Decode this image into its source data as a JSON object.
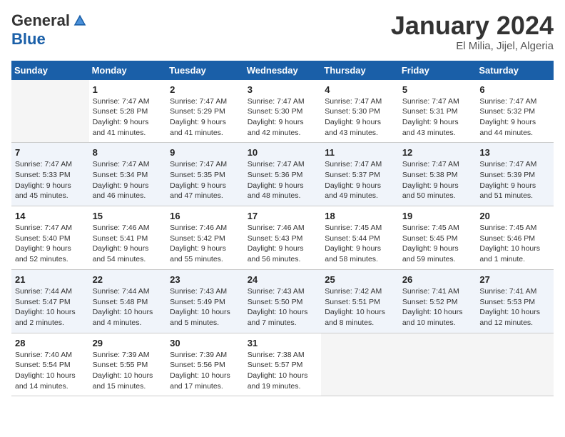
{
  "header": {
    "logo_general": "General",
    "logo_blue": "Blue",
    "month_title": "January 2024",
    "location": "El Milia, Jijel, Algeria"
  },
  "columns": [
    "Sunday",
    "Monday",
    "Tuesday",
    "Wednesday",
    "Thursday",
    "Friday",
    "Saturday"
  ],
  "weeks": [
    [
      {
        "day": "",
        "info": ""
      },
      {
        "day": "1",
        "info": "Sunrise: 7:47 AM\nSunset: 5:28 PM\nDaylight: 9 hours\nand 41 minutes."
      },
      {
        "day": "2",
        "info": "Sunrise: 7:47 AM\nSunset: 5:29 PM\nDaylight: 9 hours\nand 41 minutes."
      },
      {
        "day": "3",
        "info": "Sunrise: 7:47 AM\nSunset: 5:30 PM\nDaylight: 9 hours\nand 42 minutes."
      },
      {
        "day": "4",
        "info": "Sunrise: 7:47 AM\nSunset: 5:30 PM\nDaylight: 9 hours\nand 43 minutes."
      },
      {
        "day": "5",
        "info": "Sunrise: 7:47 AM\nSunset: 5:31 PM\nDaylight: 9 hours\nand 43 minutes."
      },
      {
        "day": "6",
        "info": "Sunrise: 7:47 AM\nSunset: 5:32 PM\nDaylight: 9 hours\nand 44 minutes."
      }
    ],
    [
      {
        "day": "7",
        "info": "Sunrise: 7:47 AM\nSunset: 5:33 PM\nDaylight: 9 hours\nand 45 minutes."
      },
      {
        "day": "8",
        "info": "Sunrise: 7:47 AM\nSunset: 5:34 PM\nDaylight: 9 hours\nand 46 minutes."
      },
      {
        "day": "9",
        "info": "Sunrise: 7:47 AM\nSunset: 5:35 PM\nDaylight: 9 hours\nand 47 minutes."
      },
      {
        "day": "10",
        "info": "Sunrise: 7:47 AM\nSunset: 5:36 PM\nDaylight: 9 hours\nand 48 minutes."
      },
      {
        "day": "11",
        "info": "Sunrise: 7:47 AM\nSunset: 5:37 PM\nDaylight: 9 hours\nand 49 minutes."
      },
      {
        "day": "12",
        "info": "Sunrise: 7:47 AM\nSunset: 5:38 PM\nDaylight: 9 hours\nand 50 minutes."
      },
      {
        "day": "13",
        "info": "Sunrise: 7:47 AM\nSunset: 5:39 PM\nDaylight: 9 hours\nand 51 minutes."
      }
    ],
    [
      {
        "day": "14",
        "info": "Sunrise: 7:47 AM\nSunset: 5:40 PM\nDaylight: 9 hours\nand 52 minutes."
      },
      {
        "day": "15",
        "info": "Sunrise: 7:46 AM\nSunset: 5:41 PM\nDaylight: 9 hours\nand 54 minutes."
      },
      {
        "day": "16",
        "info": "Sunrise: 7:46 AM\nSunset: 5:42 PM\nDaylight: 9 hours\nand 55 minutes."
      },
      {
        "day": "17",
        "info": "Sunrise: 7:46 AM\nSunset: 5:43 PM\nDaylight: 9 hours\nand 56 minutes."
      },
      {
        "day": "18",
        "info": "Sunrise: 7:45 AM\nSunset: 5:44 PM\nDaylight: 9 hours\nand 58 minutes."
      },
      {
        "day": "19",
        "info": "Sunrise: 7:45 AM\nSunset: 5:45 PM\nDaylight: 9 hours\nand 59 minutes."
      },
      {
        "day": "20",
        "info": "Sunrise: 7:45 AM\nSunset: 5:46 PM\nDaylight: 10 hours\nand 1 minute."
      }
    ],
    [
      {
        "day": "21",
        "info": "Sunrise: 7:44 AM\nSunset: 5:47 PM\nDaylight: 10 hours\nand 2 minutes."
      },
      {
        "day": "22",
        "info": "Sunrise: 7:44 AM\nSunset: 5:48 PM\nDaylight: 10 hours\nand 4 minutes."
      },
      {
        "day": "23",
        "info": "Sunrise: 7:43 AM\nSunset: 5:49 PM\nDaylight: 10 hours\nand 5 minutes."
      },
      {
        "day": "24",
        "info": "Sunrise: 7:43 AM\nSunset: 5:50 PM\nDaylight: 10 hours\nand 7 minutes."
      },
      {
        "day": "25",
        "info": "Sunrise: 7:42 AM\nSunset: 5:51 PM\nDaylight: 10 hours\nand 8 minutes."
      },
      {
        "day": "26",
        "info": "Sunrise: 7:41 AM\nSunset: 5:52 PM\nDaylight: 10 hours\nand 10 minutes."
      },
      {
        "day": "27",
        "info": "Sunrise: 7:41 AM\nSunset: 5:53 PM\nDaylight: 10 hours\nand 12 minutes."
      }
    ],
    [
      {
        "day": "28",
        "info": "Sunrise: 7:40 AM\nSunset: 5:54 PM\nDaylight: 10 hours\nand 14 minutes."
      },
      {
        "day": "29",
        "info": "Sunrise: 7:39 AM\nSunset: 5:55 PM\nDaylight: 10 hours\nand 15 minutes."
      },
      {
        "day": "30",
        "info": "Sunrise: 7:39 AM\nSunset: 5:56 PM\nDaylight: 10 hours\nand 17 minutes."
      },
      {
        "day": "31",
        "info": "Sunrise: 7:38 AM\nSunset: 5:57 PM\nDaylight: 10 hours\nand 19 minutes."
      },
      {
        "day": "",
        "info": ""
      },
      {
        "day": "",
        "info": ""
      },
      {
        "day": "",
        "info": ""
      }
    ]
  ]
}
